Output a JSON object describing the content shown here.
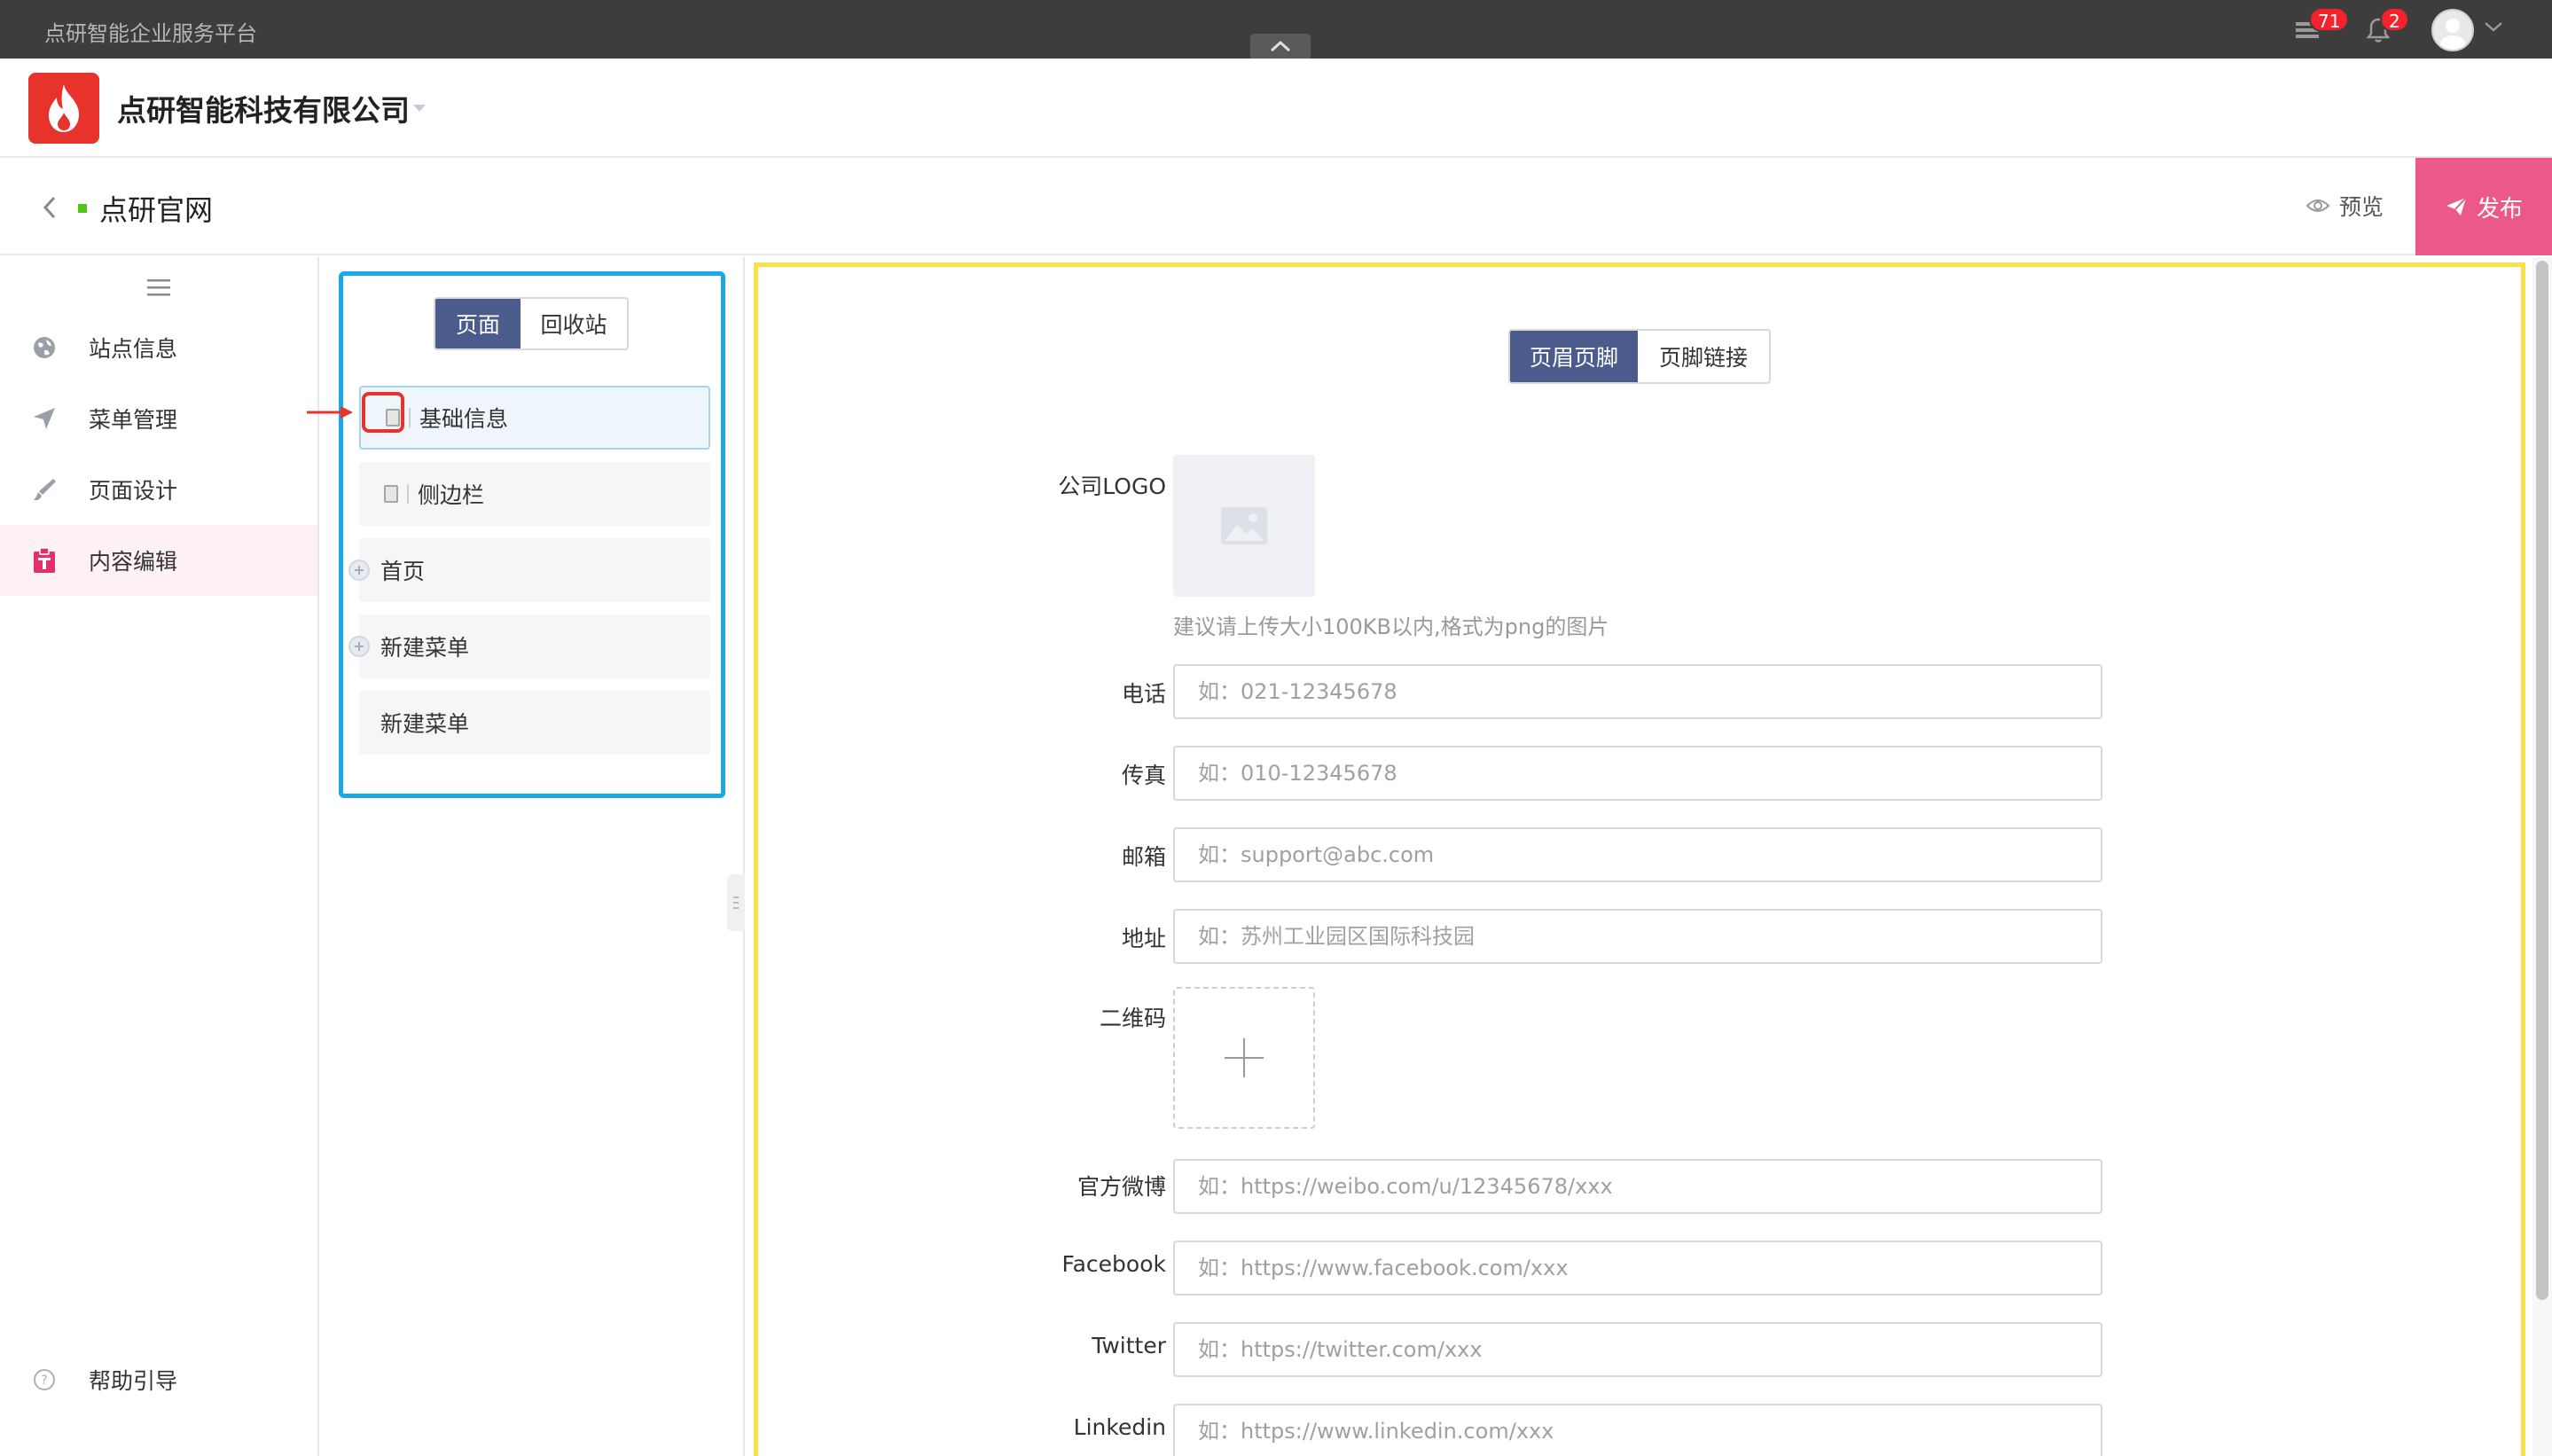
{
  "topbar": {
    "title": "点研智能企业服务平台",
    "tasks_badge": "71",
    "notifications_badge": "2"
  },
  "company": {
    "name": "点研智能科技有限公司"
  },
  "site": {
    "name": "点研官网",
    "preview_label": "预览",
    "publish_label": "发布"
  },
  "sidenav": {
    "items": [
      {
        "label": "站点信息",
        "icon": "globe-icon"
      },
      {
        "label": "菜单管理",
        "icon": "send-icon"
      },
      {
        "label": "页面设计",
        "icon": "brush-icon"
      },
      {
        "label": "内容编辑",
        "icon": "clipboard-icon",
        "active": true
      }
    ],
    "help_label": "帮助引导"
  },
  "tree": {
    "tabs": [
      "页面",
      "回收站"
    ],
    "active_tab": "页面",
    "items": [
      {
        "label": "基础信息"
      },
      {
        "label": "侧边栏"
      },
      {
        "label": "首页"
      },
      {
        "label": "新建菜单"
      },
      {
        "label": "新建菜单"
      }
    ]
  },
  "form": {
    "tabs": [
      "页眉页脚",
      "页脚链接"
    ],
    "active_tab": "页眉页脚",
    "logo_label": "公司LOGO",
    "logo_hint": "建议请上传大小100KB以内,格式为png的图片",
    "qr_label": "二维码",
    "fields": [
      {
        "label": "电话",
        "placeholder": "如：021-12345678"
      },
      {
        "label": "传真",
        "placeholder": "如：010-12345678"
      },
      {
        "label": "邮箱",
        "placeholder": "如：support@abc.com"
      },
      {
        "label": "地址",
        "placeholder": "如：苏州工业园区国际科技园"
      },
      {
        "label": "官方微博",
        "placeholder": "如：https://weibo.com/u/12345678/xxx"
      },
      {
        "label": "Facebook",
        "placeholder": "如：https://www.facebook.com/xxx"
      },
      {
        "label": "Twitter",
        "placeholder": "如：https://twitter.com/xxx"
      },
      {
        "label": "Linkedin",
        "placeholder": "如：https://www.linkedin.com/xxx"
      }
    ]
  },
  "colors": {
    "accent": "#4a5b8c",
    "publish": "#ea5987",
    "logo_red": "#e8332c",
    "tree_outline": "#1aa9e6",
    "form_outline": "#f8e24a"
  }
}
